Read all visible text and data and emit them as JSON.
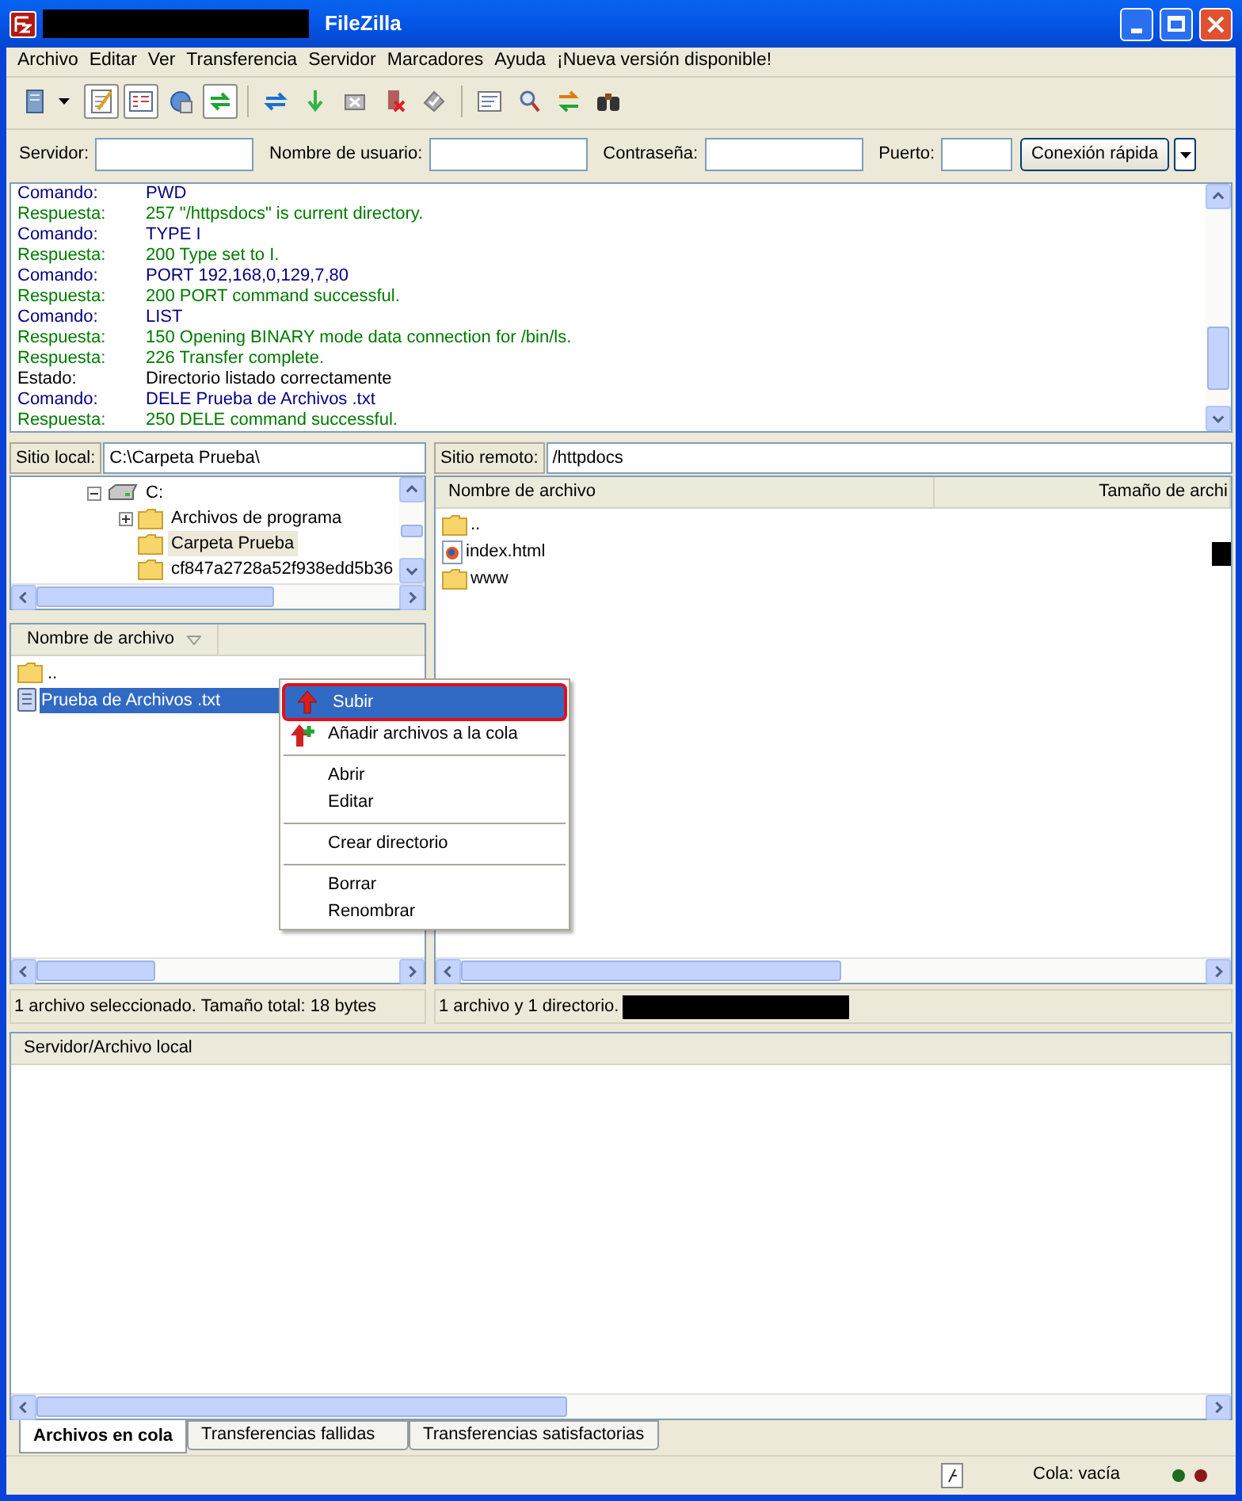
{
  "window": {
    "title": "FileZilla"
  },
  "menu": [
    "Archivo",
    "Editar",
    "Ver",
    "Transferencia",
    "Servidor",
    "Marcadores",
    "Ayuda",
    "¡Nueva versión disponible!"
  ],
  "toolbar": [
    {
      "pressed": false
    },
    {
      "pressed": true
    },
    {
      "pressed": true
    },
    {
      "pressed": false
    },
    {
      "pressed": true
    },
    {
      "pressed": false
    },
    {
      "pressed": false
    },
    {
      "pressed": false
    },
    {
      "pressed": false
    },
    {
      "pressed": false
    },
    {
      "pressed": false
    },
    {
      "pressed": false
    },
    {
      "pressed": false
    },
    {
      "pressed": false
    }
  ],
  "quickconnect": {
    "fields": [
      {
        "label": "Servidor:"
      },
      {
        "label": "Nombre de usuario:"
      },
      {
        "label": "Contraseña:"
      },
      {
        "label": "Puerto:"
      }
    ],
    "button": "Conexión rápida"
  },
  "log": [
    {
      "kind": "command",
      "type": "Comando:",
      "text": "PWD"
    },
    {
      "kind": "response",
      "type": "Respuesta:",
      "text": "257 \"/httpsdocs\" is current directory."
    },
    {
      "kind": "command",
      "type": "Comando:",
      "text": "TYPE I"
    },
    {
      "kind": "response",
      "type": "Respuesta:",
      "text": "200 Type set to I."
    },
    {
      "kind": "command",
      "type": "Comando:",
      "text": "PORT 192,168,0,129,7,80"
    },
    {
      "kind": "response",
      "type": "Respuesta:",
      "text": "200 PORT command successful."
    },
    {
      "kind": "command",
      "type": "Comando:",
      "text": "LIST"
    },
    {
      "kind": "response",
      "type": "Respuesta:",
      "text": "150 Opening BINARY mode data connection for /bin/ls."
    },
    {
      "kind": "response",
      "type": "Respuesta:",
      "text": "226 Transfer complete."
    },
    {
      "kind": "status",
      "type": "Estado:",
      "text": "Directorio listado correctamente"
    },
    {
      "kind": "command",
      "type": "Comando:",
      "text": "DELE Prueba de Archivos .txt"
    },
    {
      "kind": "response",
      "type": "Respuesta:",
      "text": "250 DELE command successful."
    }
  ],
  "local": {
    "label": "Sitio local:",
    "path": "C:\\Carpeta Prueba\\",
    "tree": [
      {
        "name": "C:",
        "kind": "drive",
        "expanded": true,
        "selected": false,
        "children": [
          {
            "name": "Archivos de programa",
            "kind": "folder",
            "expanded": false,
            "selected": false
          },
          {
            "name": "Carpeta Prueba",
            "kind": "folder",
            "selected": true
          },
          {
            "name": "cf847a2728a52f938edd5b36",
            "kind": "folder",
            "selected": false
          }
        ]
      }
    ],
    "columns": [
      "Nombre de archivo"
    ],
    "files": [
      {
        "name": "..",
        "kind": "folder",
        "selected": false
      },
      {
        "name": "Prueba de Archivos .txt",
        "kind": "text",
        "selected": true
      }
    ],
    "status": "1 archivo seleccionado. Tamaño total: 18 bytes"
  },
  "remote": {
    "label": "Sitio remoto:",
    "path": "/httpdocs",
    "columns": [
      "Nombre de archivo",
      "Tamaño de archi"
    ],
    "files": [
      {
        "name": "..",
        "kind": "folder"
      },
      {
        "name": "index.html",
        "kind": "html"
      },
      {
        "name": "www",
        "kind": "folder"
      }
    ],
    "status": "1 archivo y 1 directorio."
  },
  "context_menu": {
    "groups": [
      {
        "items": [
          {
            "label": "Subir",
            "kind": "upload",
            "selected": true
          },
          {
            "label": "Añadir archivos a la cola",
            "kind": "enqueue",
            "selected": false
          }
        ]
      },
      {
        "items": [
          {
            "label": "Abrir",
            "kind": "plain",
            "selected": false
          },
          {
            "label": "Editar",
            "kind": "plain",
            "selected": false
          }
        ]
      },
      {
        "items": [
          {
            "label": "Crear directorio",
            "kind": "plain",
            "selected": false
          }
        ]
      },
      {
        "items": [
          {
            "label": "Borrar",
            "kind": "plain",
            "selected": false
          },
          {
            "label": "Renombrar",
            "kind": "plain",
            "selected": false
          }
        ]
      }
    ]
  },
  "queue": {
    "columns": [
      "Servidor/Archivo local"
    ],
    "tabs": [
      {
        "label": "Archivos en cola",
        "selected": true
      },
      {
        "label": "Transferencias fallidas",
        "selected": false
      },
      {
        "label": "Transferencias satisfactorias",
        "selected": false
      }
    ]
  },
  "status_bar": {
    "queue": "Cola: vacía"
  }
}
